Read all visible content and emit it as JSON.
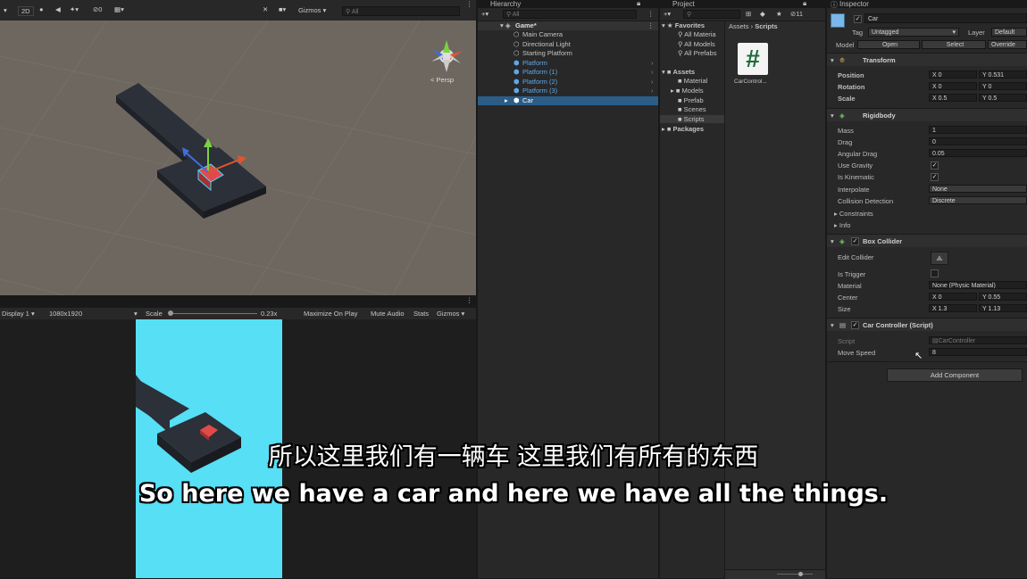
{
  "scene_toolbar": {
    "mode_2d": "2D",
    "audio_count": "0",
    "gizmos": "Gizmos",
    "search_placeholder": "All"
  },
  "scene_view": {
    "persp_label": "< Persp"
  },
  "game_toolbar": {
    "display": "Display 1",
    "resolution": "1080x1920",
    "scale_label": "Scale",
    "scale_value": "0.23x",
    "maximize": "Maximize On Play",
    "mute": "Mute Audio",
    "stats": "Stats",
    "gizmos": "Gizmos"
  },
  "hierarchy": {
    "tab": "Hierarchy",
    "search_placeholder": "All",
    "root": "Game*",
    "items": [
      "Main Camera",
      "Directional Light",
      "Starting Platform",
      "Platform",
      "Platform (1)",
      "Platform (2)",
      "Platform (3)",
      "Car"
    ]
  },
  "project": {
    "tab": "Project",
    "count": "11",
    "favorites": "Favorites",
    "fav_items": [
      "All Materia",
      "All Models",
      "All Prefabs"
    ],
    "assets": "Assets",
    "asset_folders": [
      "Material",
      "Models",
      "Prefab",
      "Scenes",
      "Scripts"
    ],
    "packages": "Packages",
    "breadcrumb_root": "Assets",
    "breadcrumb_current": "Scripts",
    "file_name": "CarControl...",
    "file_glyph": "#"
  },
  "inspector": {
    "tab": "Inspector",
    "object_name": "Car",
    "tag_label": "Tag",
    "tag_value": "Untagged",
    "layer_label": "Layer",
    "layer_value": "Default",
    "model_label": "Model",
    "model_open": "Open",
    "model_select": "Select",
    "model_overrides": "Override",
    "transform": {
      "title": "Transform",
      "position_label": "Position",
      "rotation_label": "Rotation",
      "scale_label": "Scale",
      "position": [
        "X 0",
        "Y 0.531"
      ],
      "rotation": [
        "X 0",
        "Y 0"
      ],
      "scale": [
        "X 0.5",
        "Y 0.5"
      ]
    },
    "rigidbody": {
      "title": "Rigidbody",
      "rows": [
        {
          "label": "Mass",
          "value": "1"
        },
        {
          "label": "Drag",
          "value": "0"
        },
        {
          "label": "Angular Drag",
          "value": "0.05"
        },
        {
          "label": "Use Gravity",
          "value": "✓"
        },
        {
          "label": "Is Kinematic",
          "value": "✓"
        },
        {
          "label": "Interpolate",
          "value": "None"
        },
        {
          "label": "Collision Detection",
          "value": "Discrete"
        }
      ],
      "constraints": "Constraints",
      "info": "Info"
    },
    "box_collider": {
      "title": "Box Collider",
      "edit_collider": "Edit Collider",
      "is_trigger": "Is Trigger",
      "material_label": "Material",
      "material_value": "None (Physic Material)",
      "center_label": "Center",
      "center": [
        "X 0",
        "Y 0.55"
      ],
      "size_label": "Size",
      "size": [
        "X 1.3",
        "Y 1.13"
      ]
    },
    "car_controller": {
      "title": "Car Controller (Script)",
      "script_label": "Script",
      "script_value": "CarController",
      "move_speed_label": "Move Speed",
      "move_speed_value": "8"
    },
    "add_component": "Add Component"
  },
  "subtitles": {
    "chinese": "所以这里我们有一辆车 这里我们有所有的东西",
    "english": "So here we have a car and here we have all the things."
  },
  "colors": {
    "selection": "#2c5d87",
    "game_bg": "#56dff5",
    "scene_ground": "#6e6760",
    "platform": "#2c3038"
  }
}
